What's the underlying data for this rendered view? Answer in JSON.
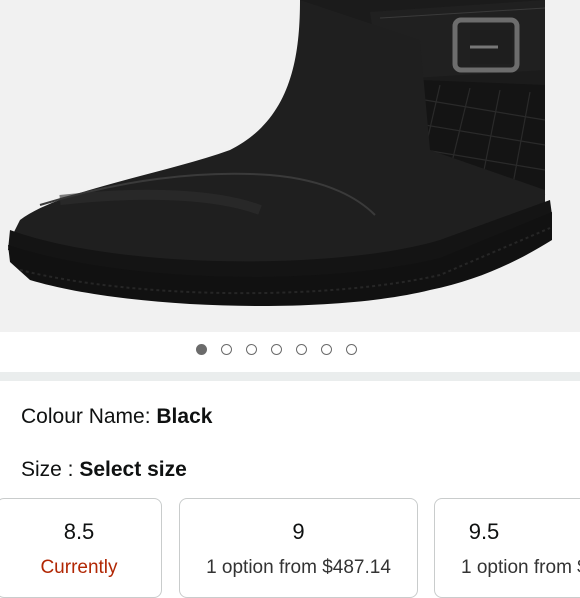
{
  "product": {
    "image": {
      "alt_icon": "black-leather-ankle-boot-image",
      "total_images": 7,
      "active_index": 0
    },
    "colour": {
      "label": "Colour Name: ",
      "value": "Black"
    },
    "size": {
      "label": "Size : ",
      "value": "Select size"
    },
    "size_options": [
      {
        "size": "8.5",
        "availability": "Currently",
        "status_color": "#b12704"
      },
      {
        "size": "9",
        "availability": "1 option from $487.14",
        "status_color": "#333333"
      },
      {
        "size": "9.5",
        "availability": "1 option from $",
        "status_color": "#333333"
      }
    ]
  },
  "colors": {
    "hero_bg": "#f1f1f1",
    "divider": "#eaeded",
    "alert": "#b12704"
  }
}
